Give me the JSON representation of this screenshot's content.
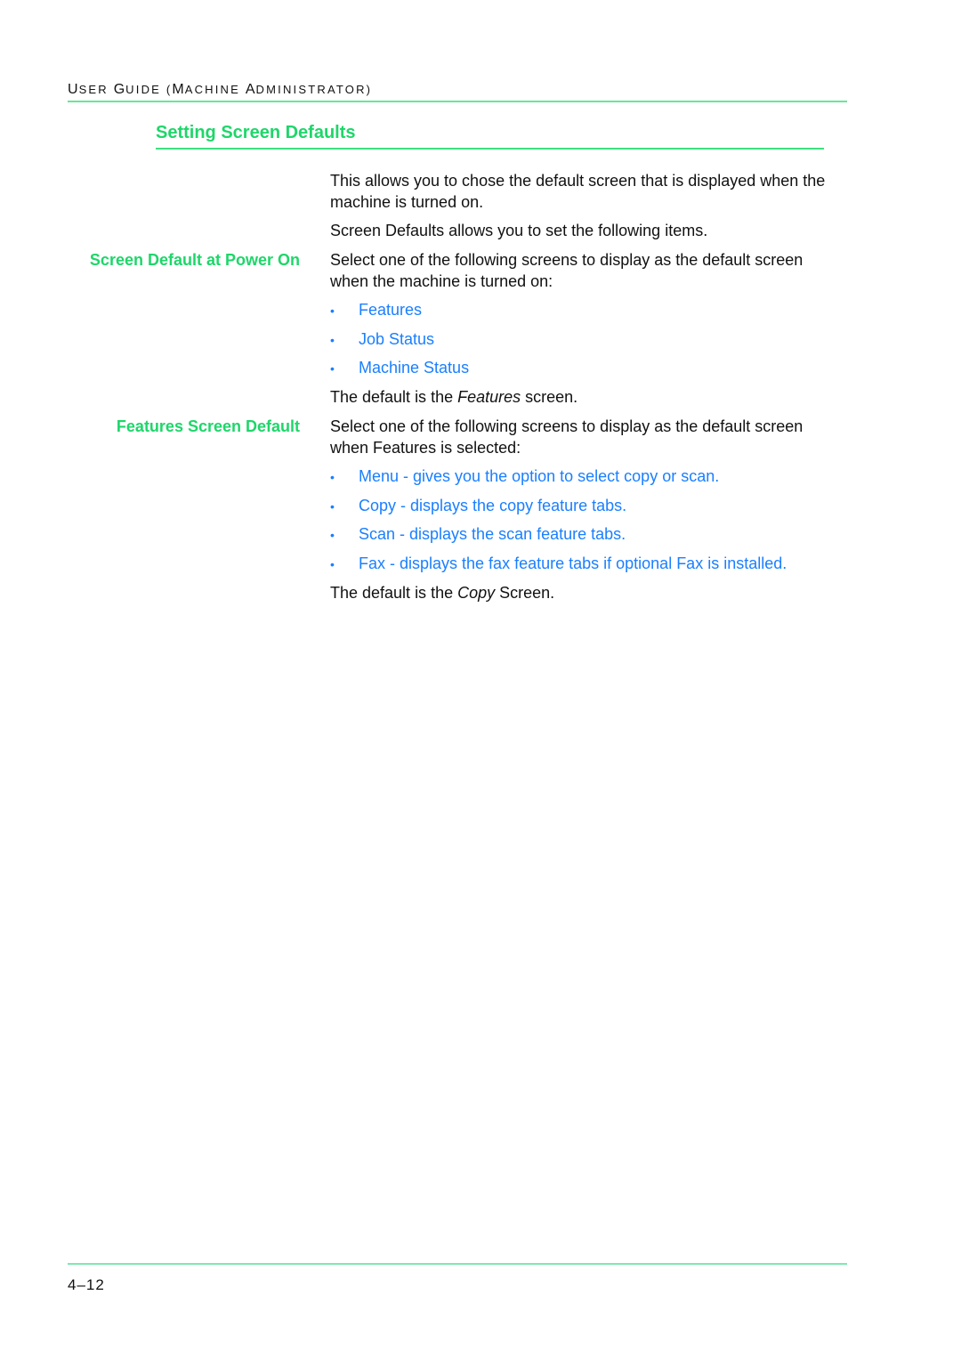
{
  "header": {
    "running_head": {
      "U1": "U",
      "r1": "SER ",
      "G": "G",
      "r2": "UIDE (",
      "M": "M",
      "r3": "ACHINE ",
      "A": "A",
      "r4": "DMINISTRATOR)"
    },
    "running_head_full": "User Guide (Machine Administrator)"
  },
  "section": {
    "title": "Setting Screen Defaults",
    "intro": "This allows you to chose the default screen that is displayed when the machine is turned on.",
    "items_intro": "Screen Defaults allows you to set the following items."
  },
  "power_on": {
    "heading": "Screen Default at Power On",
    "text": "Select one of the following screens to display as the default screen when the machine is turned on:",
    "bullets": [
      "Features",
      "Job Status",
      "Machine Status"
    ],
    "default_prefix": "The default is the ",
    "default_value": "Features",
    "default_suffix": " screen."
  },
  "features_default": {
    "heading": "Features Screen Default",
    "text": "Select one of the following screens to display as the default screen when Features is selected:",
    "bullets": [
      "Menu - gives you the option to select copy or scan.",
      "Copy - displays the copy feature tabs.",
      "Scan - displays the scan feature tabs.",
      "Fax - displays the fax feature tabs if optional Fax is installed."
    ],
    "default_prefix": "The default is the ",
    "default_value": "Copy",
    "default_suffix": " Screen."
  },
  "footer": {
    "page_number": "4–12"
  },
  "colors": {
    "heading_green": "#1ed66a",
    "link_blue": "#1a7fff",
    "rule_green": "#66e699"
  },
  "bullet_glyph": "•"
}
